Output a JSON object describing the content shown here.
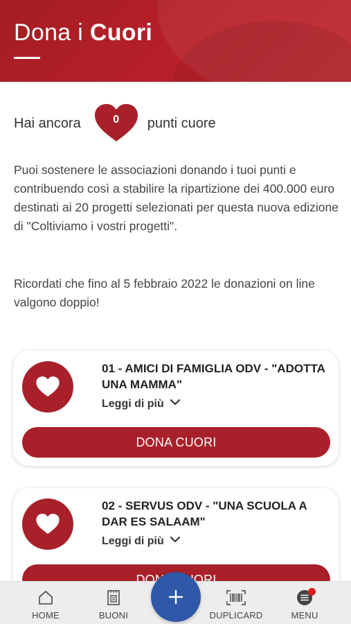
{
  "header": {
    "title_light": "Dona i",
    "title_bold": "Cuori"
  },
  "points": {
    "prefix": "Hai ancora",
    "value": "0",
    "suffix": "punti cuore"
  },
  "intro": {
    "paragraph1": "Puoi sostenere le associazioni donando i tuoi punti e contribuendo così a stabilire la ripartizione dei 400.000 euro destinati ai 20 progetti selezionati per questa nuova edizione di \"Coltiviamo i vostri progetti\".",
    "paragraph2": "Ricordati che fino al 5 febbraio 2022 le donazioni on line valgono doppio!"
  },
  "projects": [
    {
      "title": "01 - AMICI DI FAMIGLIA ODV - \"ADOTTA UNA MAMMA\"",
      "more_label": "Leggi di più",
      "button_label": "DONA CUORI"
    },
    {
      "title": "02 - SERVUS ODV - \"UNA SCUOLA A DAR ES SALAAM\"",
      "more_label": "Leggi di più",
      "button_label": "DONA CUORI"
    }
  ],
  "bottom_nav": {
    "home": "HOME",
    "buoni": "BUONI",
    "duplicard": "DUPLICARD",
    "menu": "MENU",
    "icons": {
      "home": "home-icon",
      "buoni": "voucher-icon",
      "fab": "plus-icon",
      "duplicard": "barcode-icon",
      "menu": "menu-icon"
    }
  },
  "colors": {
    "brand_red": "#a8212a",
    "fab_blue": "#2f58a8",
    "notification": "#e01b1b"
  }
}
